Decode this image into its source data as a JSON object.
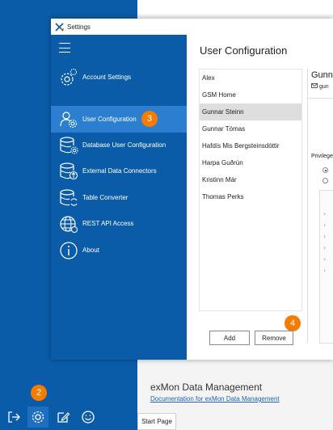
{
  "dialog": {
    "title": "Settings",
    "nav_items": [
      {
        "label": "Account Settings",
        "icon": "account-settings-icon"
      },
      {
        "label": "User Configuration",
        "icon": "user-configuration-icon"
      },
      {
        "label": "Database User Configuration",
        "icon": "database-user-icon"
      },
      {
        "label": "External Data Connectors",
        "icon": "external-data-icon"
      },
      {
        "label": "Table Converter",
        "icon": "table-converter-icon"
      },
      {
        "label": "REST API Access",
        "icon": "globe-icon"
      },
      {
        "label": "About",
        "icon": "info-icon"
      }
    ],
    "selected_nav_index": 1
  },
  "user_config": {
    "title": "User Configuration",
    "users": [
      "Alex",
      "GSM Home",
      "Gunnar Steinn",
      "Gunnar Tómas",
      "Hafdís Mis Bergsteinsdóttir",
      "Harpa Guðrún",
      "Kristinn Már",
      "Thomas Perks"
    ],
    "selected_user_index": 2,
    "add_label": "Add",
    "remove_label": "Remove",
    "detail": {
      "name_partial": "Gunn",
      "email_partial": "gun",
      "privileges_label": "Privilege"
    }
  },
  "badges": {
    "step2": "2",
    "step3": "3",
    "step4": "4"
  },
  "background": {
    "section_title": "exMon Data Management",
    "doc_link": "Documentation for exMon Data Management",
    "start_tab": "Start Page"
  },
  "colors": {
    "sidebar_blue": "#0a5ca8",
    "selected_nav": "#2c7fd0",
    "badge_orange": "#f57c00",
    "selected_row": "#dedede"
  }
}
